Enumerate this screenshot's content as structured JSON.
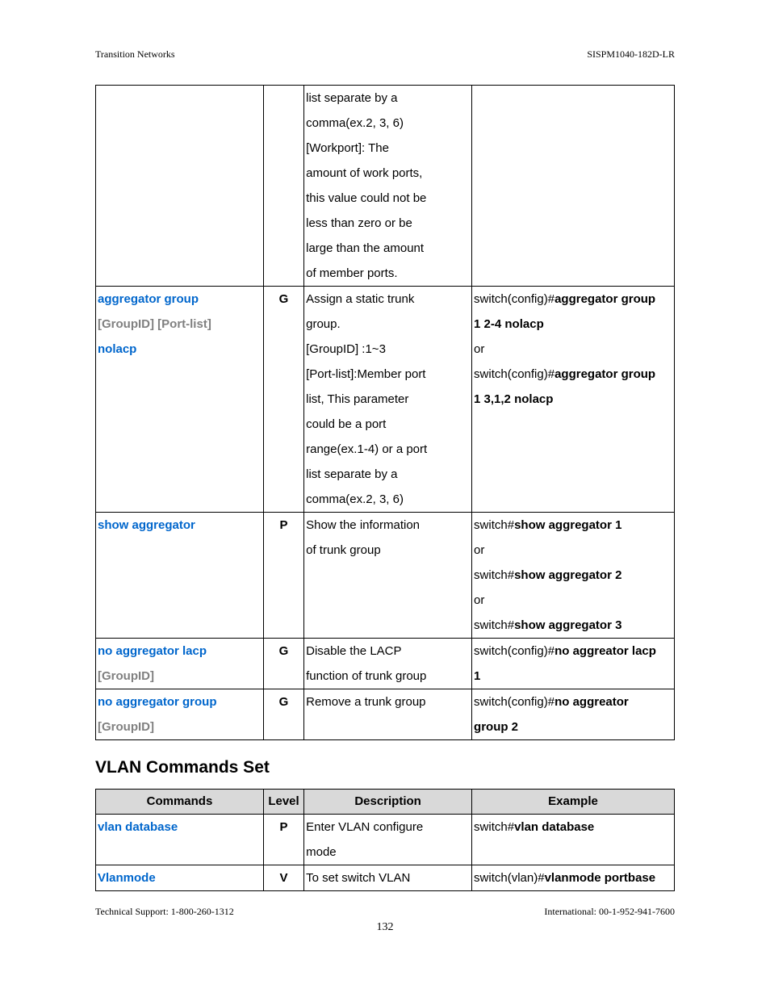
{
  "header": {
    "left": "Transition Networks",
    "right": "SISPM1040-182D-LR"
  },
  "footer": {
    "left": "Technical Support: 1-800-260-1312",
    "right": "International: 00-1-952-941-7600",
    "page": "132"
  },
  "t1": {
    "r0": {
      "desc": [
        "list separate by a",
        "comma(ex.2, 3, 6)",
        "[Workport]: The",
        "amount of work ports,",
        "this value could not be",
        "less than zero or be",
        "large than the amount",
        "of member ports."
      ]
    },
    "r1": {
      "cmd_l1": "aggregator group",
      "cmd_l2": "[GroupID] [Port-list]",
      "cmd_l3": "nolacp",
      "level": "G",
      "desc": [
        "Assign a static trunk",
        "group.",
        "[GroupID] :1~3",
        "[Port-list]:Member port",
        "list, This parameter",
        "could be a port",
        "range(ex.1-4) or a port",
        "list separate by a",
        "comma(ex.2, 3, 6)"
      ],
      "ex_pref": "switch(config)#",
      "ex_bold_a": "aggregator group",
      "ex_bold_b": "1 2-4 nolacp",
      "ex_or": "or",
      "ex_bold_c": "aggregator group",
      "ex_bold_d": "1 3,1,2 nolacp"
    },
    "r2": {
      "cmd_l1": "show aggregator",
      "level": "P",
      "desc": [
        "Show the information",
        "of trunk group"
      ],
      "ex_pref": "switch#",
      "ex_bold_a": "show aggregator 1",
      "ex_or1": "or",
      "ex_bold_b": "show aggregator 2",
      "ex_or2": "or",
      "ex_bold_c": "show aggregator 3"
    },
    "r3": {
      "cmd_l1": "no aggregator lacp",
      "cmd_l2": "[GroupID]",
      "level": "G",
      "desc": [
        "Disable the LACP",
        "function of trunk group"
      ],
      "ex_pref": "switch(config)#",
      "ex_bold_a": "no aggreator lacp",
      "ex_bold_b": "1"
    },
    "r4": {
      "cmd_l1": "no aggregator group",
      "cmd_l2": "[GroupID]",
      "level": "G",
      "desc_l1": "Remove a trunk group",
      "ex_pref": "switch(config)#",
      "ex_bold_a": "no aggreator",
      "ex_bold_b": "group 2"
    }
  },
  "section_title": "VLAN Commands Set",
  "t2": {
    "head": {
      "c1": "Commands",
      "c2": "Level",
      "c3": "Description",
      "c4": "Example"
    },
    "r1": {
      "cmd_l1": "vlan database",
      "level": "P",
      "desc": [
        "Enter VLAN configure",
        "mode"
      ],
      "ex_pref": "switch#",
      "ex_bold": "vlan database"
    },
    "r2": {
      "cmd_l1": "Vlanmode",
      "level": "V",
      "desc_l1": "To set switch VLAN",
      "ex_pref": "switch(vlan)#",
      "ex_bold": "vlanmode portbase"
    }
  }
}
